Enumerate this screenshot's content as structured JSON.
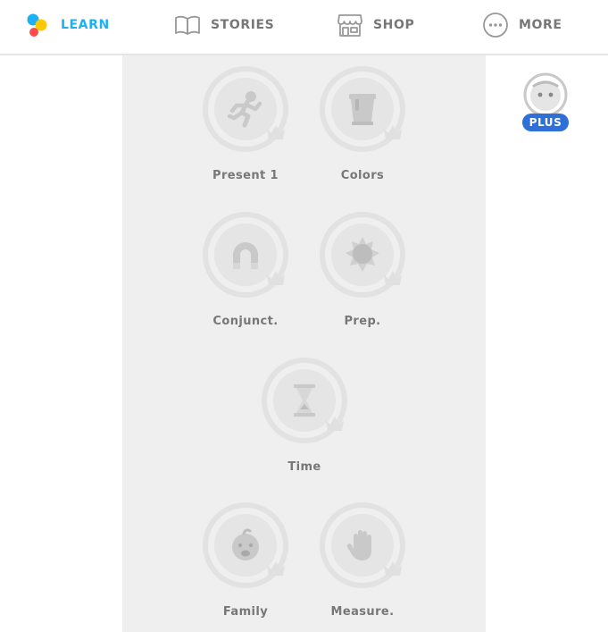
{
  "nav": {
    "items": [
      {
        "label": "LEARN",
        "icon": "learn-dots-icon",
        "active": true
      },
      {
        "label": "STORIES",
        "icon": "book-icon",
        "active": false
      },
      {
        "label": "SHOP",
        "icon": "shop-icon",
        "active": false
      },
      {
        "label": "MORE",
        "icon": "more-dots-icon",
        "active": false
      }
    ]
  },
  "colors": {
    "accent": "#1cb0f6",
    "locked_text": "#777777",
    "plus": "#2e6fd8"
  },
  "skills": [
    {
      "name": "Present 1",
      "icon": "running-person-icon"
    },
    {
      "name": "Colors",
      "icon": "paint-bucket-icon"
    },
    {
      "name": "Conjunct.",
      "icon": "magnet-icon"
    },
    {
      "name": "Prep.",
      "icon": "sun-icon"
    },
    {
      "name": "Time",
      "icon": "hourglass-icon"
    },
    {
      "name": "Family",
      "icon": "baby-icon"
    },
    {
      "name": "Measure.",
      "icon": "hand-icon"
    }
  ],
  "profile": {
    "badge": "PLUS",
    "icon": "avatar-icon"
  }
}
